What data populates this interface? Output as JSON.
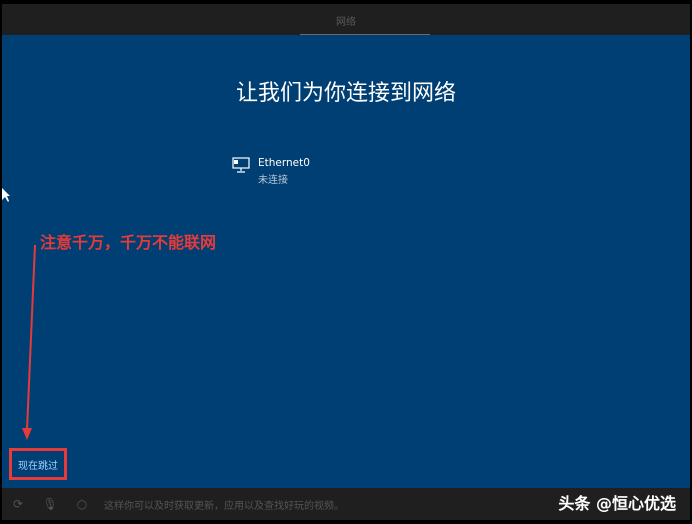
{
  "header": {
    "title": "网络"
  },
  "main": {
    "title": "让我们为你连接到网络",
    "network": {
      "name": "Ethernet0",
      "status": "未连接"
    },
    "skip_label": "现在跳过"
  },
  "annotation": {
    "text": "注意千万，千万不能联网",
    "color": "#e63a3a"
  },
  "bottom": {
    "message": "这样你可以及时获取更新，应用以及查找好玩的视频。"
  },
  "watermark": "头条 @恒心优选"
}
